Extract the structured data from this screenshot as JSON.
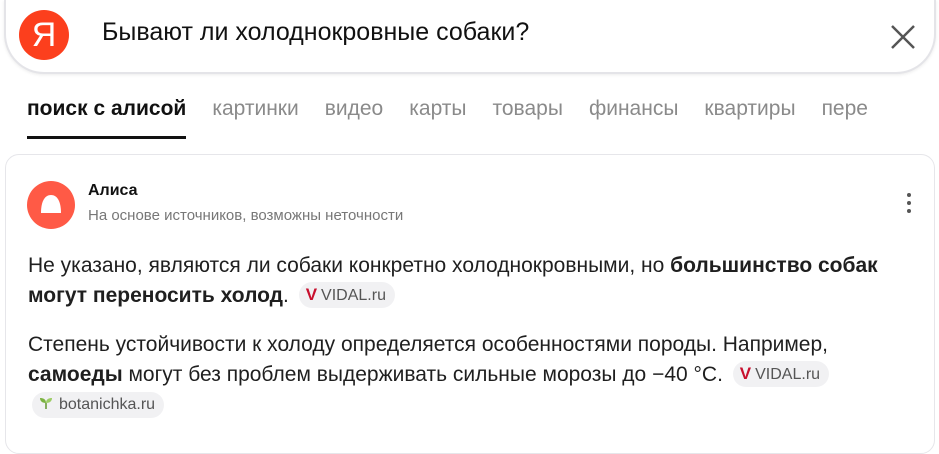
{
  "search": {
    "logo_letter": "Я",
    "query": "Бывают ли холоднокровные собаки?"
  },
  "tabs": [
    {
      "label": "поиск с алисой",
      "active": true
    },
    {
      "label": "картинки"
    },
    {
      "label": "видео"
    },
    {
      "label": "карты"
    },
    {
      "label": "товары"
    },
    {
      "label": "финансы"
    },
    {
      "label": "квартиры"
    },
    {
      "label": "пере"
    }
  ],
  "answer": {
    "source_name": "Алиса",
    "disclaimer": "На основе источников, возможны неточности",
    "p1_text": "Не указано, являются ли собаки конкретно холоднокровными, но ",
    "p1_bold": "большинство собак могут переносить холод",
    "p1_end": ".",
    "p2_text1": "Степень устойчивости к холоду определяется особенностями породы. Например, ",
    "p2_bold": "самоеды",
    "p2_text2": " могут без проблем выдерживать сильные морозы до −40 °C.",
    "sources": [
      {
        "name": "VIDAL.ru",
        "icon": "vidal-logo-icon"
      },
      {
        "name": "VIDAL.ru",
        "icon": "vidal-logo-icon"
      },
      {
        "name": "botanichka.ru",
        "icon": "sprout-icon"
      }
    ]
  },
  "colors": {
    "yandex_red": "#fc3f1d",
    "alice": "#ff5a46",
    "vidal": "#c8102e"
  }
}
